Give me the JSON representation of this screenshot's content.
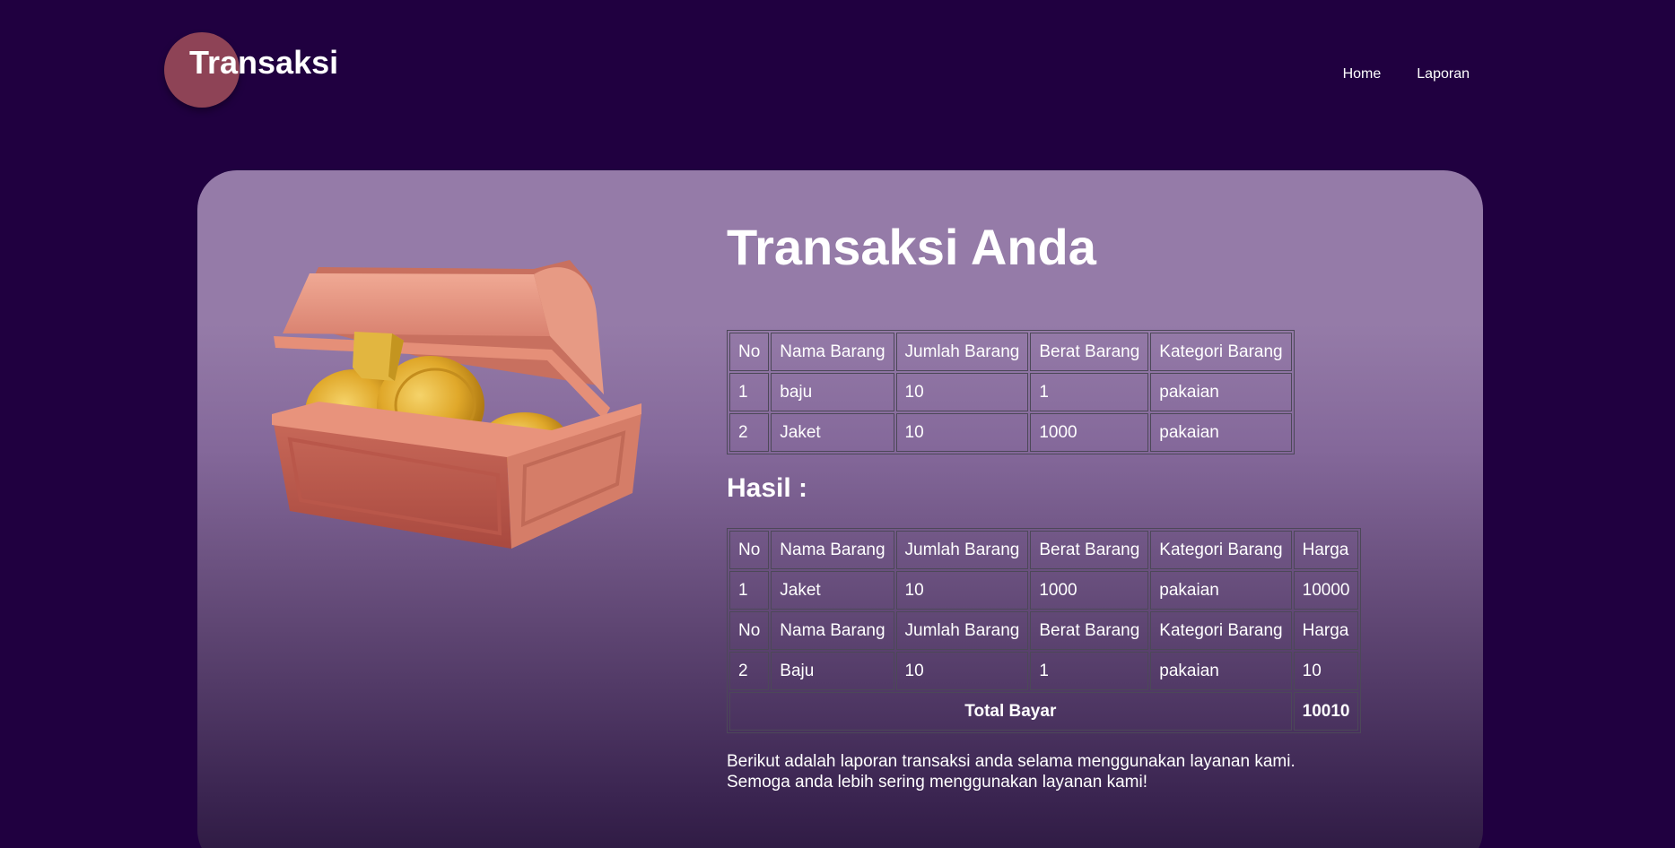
{
  "header": {
    "logo_text": "Transaksi",
    "nav": [
      "Home",
      "Laporan"
    ]
  },
  "main": {
    "title": "Transaksi Anda",
    "image_icon": "treasure-chest-icon",
    "table1": {
      "headers": [
        "No",
        "Nama Barang",
        "Jumlah Barang",
        "Berat Barang",
        "Kategori Barang"
      ],
      "rows": [
        [
          "1",
          "baju",
          "10",
          "1",
          "pakaian"
        ],
        [
          "2",
          "Jaket",
          "10",
          "1000",
          "pakaian"
        ]
      ]
    },
    "hasil_label": "Hasil :",
    "table2": {
      "headers": [
        "No",
        "Nama Barang",
        "Jumlah Barang",
        "Berat Barang",
        "Kategori Barang",
        "Harga"
      ],
      "rows": [
        [
          "1",
          "Jaket",
          "10",
          "1000",
          "pakaian",
          "10000"
        ],
        [
          "2",
          "Baju",
          "10",
          "1",
          "pakaian",
          "10"
        ]
      ],
      "total_label": "Total Bayar",
      "total_value": "10010"
    },
    "note_line1": "Berikut adalah laporan transaksi anda selama menggunakan layanan kami.",
    "note_line2": "Semoga anda lebih sering menggunakan layanan kami!"
  },
  "colors": {
    "background": "#200040",
    "card": "#957ba8",
    "logo_circle": "#8e4356",
    "text": "#ffffff"
  }
}
